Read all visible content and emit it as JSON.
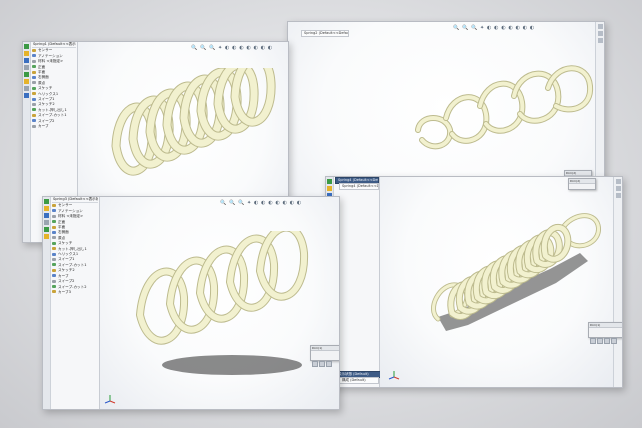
{
  "toolbar_icons": "🔍 🔍 🔍 ✦ ◐ ◐ ◐ ◐ ◐ ◐ ◐",
  "windows": [
    {
      "id": "spring-1",
      "title": "Spring1 (Default<<表示状態-1>>)",
      "tree_items": [
        "センサー",
        "アノテーション",
        "材料 <未指定>",
        "正面",
        "平面",
        "右側面",
        "原点",
        "スケッチ",
        "ヘリックス1",
        "スイープ1",
        "スケッチ2",
        "カット-押し出し1",
        "スイープ-カット1",
        "スイープ2",
        "カーブ"
      ],
      "viewport_label": "",
      "dialog_title": ""
    },
    {
      "id": "spring-2",
      "title": "Spring2 (Default)",
      "config_tabs": "Spring2  (Default<<Default>> )",
      "dialog_title": "Dim(2)"
    },
    {
      "id": "spring-3",
      "title": "Spring3 (Default<<表示状態-1>>)",
      "tree_items": [
        "センサー",
        "アノテーション",
        "材料 <未指定>",
        "正面",
        "平面",
        "右側面",
        "原点",
        "スケッチ",
        "カット-押し出し1",
        "ヘリックス1",
        "スイープ1",
        "スイープ-カット1",
        "スケッチ2",
        "カーブ",
        "スイープ2",
        "スイープ-カット2",
        "カーブ3"
      ],
      "dialog_title": "Dim(1)"
    },
    {
      "id": "spring-4",
      "title": "Spring4 (Default)",
      "config_tabs": "Spring4 (Default<<Default>> )",
      "bottom_tabs": "表示状態 (Default)",
      "bottom_tabs_2": "構成 (Default)",
      "dialog_title": "Dim(2)",
      "dialog_title_2": "Dim(1)"
    }
  ],
  "colors": {
    "spring_fill": "#f2f1cf",
    "spring_edge": "#bdbb8e",
    "shadow": "#2b2b2b",
    "accent_blue": "#3a6fc0"
  },
  "icons": [
    "zoom-icon",
    "rotate-icon",
    "display-style-icon",
    "view-orientation-icon",
    "triad-icon"
  ]
}
